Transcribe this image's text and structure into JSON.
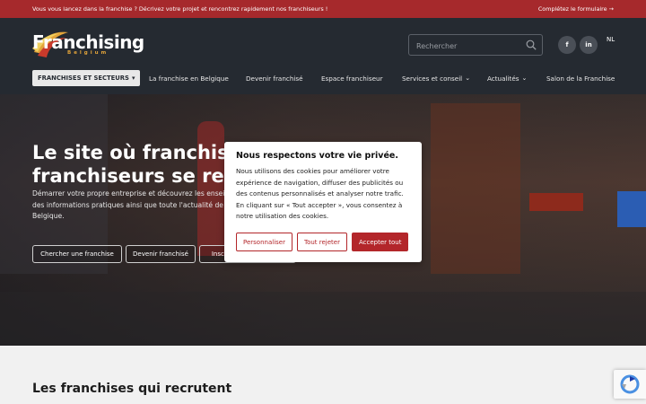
{
  "topbar": {
    "promo_text": "Vous vous lancez dans la franchise ? Décrivez votre projet et rencontrez rapidement nos franchiseurs !",
    "cta_text": "Complétez le formulaire →"
  },
  "header": {
    "logo_text": "Franchising",
    "logo_sub": "Belgium",
    "search_placeholder": "Rechercher",
    "social": [
      "f",
      "in"
    ],
    "lang": "NL"
  },
  "nav": {
    "items": [
      {
        "label": "FRANCHISES ET SECTEURS",
        "active": true,
        "dropdown": true
      },
      {
        "label": "La franchise en Belgique"
      },
      {
        "label": "Devenir franchisé"
      },
      {
        "label": "Espace franchiseur"
      },
      {
        "label": "Services et conseil",
        "dropdown": true
      },
      {
        "label": "Actualités",
        "dropdown": true
      },
      {
        "label": "Salon de la Franchise"
      }
    ]
  },
  "hero": {
    "title_line1": "Le site où franchisés et",
    "title_line2": "franchiseurs se rencontrent",
    "description": "Démarrer votre propre entreprise et découvrez les enseignes qui recrutent, des informations pratiques ainsi que toute l'actualité de la franchise en Belgique.",
    "buttons": [
      "Chercher une franchise",
      "Devenir franchisé",
      "Inscrire votre enseigne"
    ]
  },
  "cookie": {
    "title": "Nous respectons votre vie privée.",
    "text": "Nous utilisons des cookies pour améliorer votre expérience de navigation, diffuser des publicités ou des contenus personnalisés et analyser notre trafic. En cliquant sur « Tout accepter », vous consentez à notre utilisation des cookies.",
    "customize_label": "Personnaliser",
    "reject_label": "Tout rejeter",
    "accept_label": "Accepter tout"
  },
  "section": {
    "heading": "Les franchises qui recrutent"
  },
  "colors": {
    "topbar": "#a6292c",
    "header": "#252a31",
    "accent": "#b3262a"
  }
}
